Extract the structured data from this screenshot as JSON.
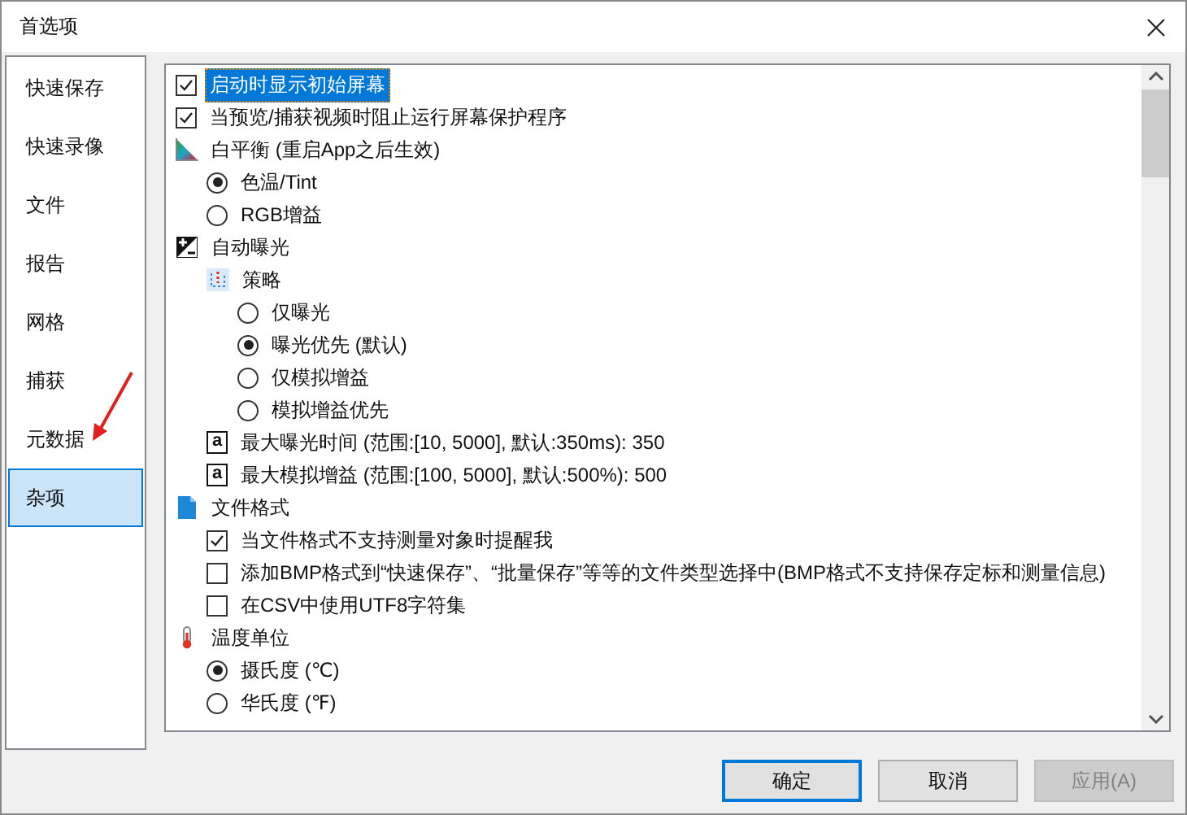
{
  "window": {
    "title": "首选项"
  },
  "sidebar": {
    "items": [
      {
        "label": "快速保存",
        "selected": false
      },
      {
        "label": "快速录像",
        "selected": false
      },
      {
        "label": "文件",
        "selected": false
      },
      {
        "label": "报告",
        "selected": false
      },
      {
        "label": "网格",
        "selected": false
      },
      {
        "label": "捕获",
        "selected": false
      },
      {
        "label": "元数据",
        "selected": false
      },
      {
        "label": "杂项",
        "selected": true
      }
    ]
  },
  "settings": [
    {
      "kind": "checkbox",
      "label": "启动时显示初始屏幕",
      "checked": true,
      "selected": true
    },
    {
      "kind": "checkbox",
      "label": "当预览/捕获视频时阻止运行屏幕保护程序",
      "checked": true,
      "selected": false
    },
    {
      "kind": "color-group",
      "label": "白平衡 (重启App之后生效)",
      "selected": false,
      "children": [
        {
          "kind": "radio",
          "label": "色温/Tint",
          "checked": true,
          "selected": false
        },
        {
          "kind": "radio",
          "label": "RGB增益",
          "checked": false,
          "selected": false
        }
      ]
    },
    {
      "kind": "exposure-group",
      "label": "自动曝光",
      "selected": false,
      "children": [
        {
          "kind": "strategy-group",
          "label": "策略",
          "selected": false,
          "children": [
            {
              "kind": "radio",
              "label": "仅曝光",
              "checked": false,
              "selected": false
            },
            {
              "kind": "radio",
              "label": "曝光优先 (默认)",
              "checked": true,
              "selected": false
            },
            {
              "kind": "radio",
              "label": "仅模拟增益",
              "checked": false,
              "selected": false
            },
            {
              "kind": "radio",
              "label": "模拟增益优先",
              "checked": false,
              "selected": false
            }
          ]
        },
        {
          "kind": "input",
          "badge": "a",
          "label": "最大曝光时间 (范围:[10, 5000], 默认:350ms): 350",
          "selected": false
        },
        {
          "kind": "input",
          "badge": "a",
          "label": "最大模拟增益 (范围:[100, 5000], 默认:500%): 500",
          "selected": false
        }
      ]
    },
    {
      "kind": "file-group",
      "label": "文件格式",
      "selected": false,
      "children": [
        {
          "kind": "checkbox",
          "label": "当文件格式不支持测量对象时提醒我",
          "checked": true,
          "selected": false
        },
        {
          "kind": "checkbox",
          "label": "添加BMP格式到“快速保存”、“批量保存”等等的文件类型选择中(BMP格式不支持保存定标和测量信息)",
          "checked": false,
          "selected": false
        },
        {
          "kind": "checkbox",
          "label": "在CSV中使用UTF8字符集",
          "checked": false,
          "selected": false
        }
      ]
    },
    {
      "kind": "temperature-group",
      "label": "温度单位",
      "selected": false,
      "children": [
        {
          "kind": "radio",
          "label": "摄氏度 (℃)",
          "checked": true,
          "selected": false
        },
        {
          "kind": "radio",
          "label": "华氏度 (℉)",
          "checked": false,
          "selected": false
        }
      ]
    }
  ],
  "buttons": [
    {
      "label": "确定",
      "kind": "default",
      "disabled": false
    },
    {
      "label": "取消",
      "kind": "normal",
      "disabled": false
    },
    {
      "label": "应用(A)",
      "kind": "normal",
      "disabled": true
    }
  ]
}
